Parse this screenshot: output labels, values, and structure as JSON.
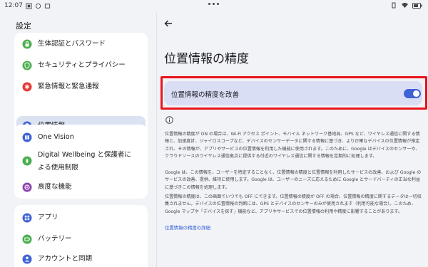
{
  "status_bar": {
    "time": "12:07"
  },
  "left_pane": {
    "title": "設定",
    "group1": [
      {
        "label": "生体認証とパスワード",
        "icon": "lock-icon",
        "color": "#4caf50"
      },
      {
        "label": "セキュリティとプライバシー",
        "icon": "shield-icon",
        "color": "#4caf50"
      },
      {
        "label": "緊急情報と緊急通報",
        "icon": "emergency-icon",
        "color": "#e53935"
      },
      {
        "label": "位置情報",
        "icon": "location-pin-icon",
        "color": "#3f63d6",
        "selected": true
      }
    ],
    "group2": [
      {
        "label": "One Vision",
        "icon": "one-vision-icon",
        "color": "#3f63d6"
      },
      {
        "label_line1": "Digital Wellbeing と保護者に",
        "label_line2": "よる使用制限",
        "icon": "wellbeing-icon",
        "color": "#4caf50"
      },
      {
        "label": "高度な機能",
        "icon": "advanced-features-icon",
        "color": "#8e44ad"
      }
    ],
    "group3": [
      {
        "label": "アプリ",
        "icon": "apps-icon",
        "color": "#3f63d6"
      },
      {
        "label": "バッテリー",
        "icon": "battery-icon",
        "color": "#4caf50"
      },
      {
        "label": "アカウントと同期",
        "icon": "account-icon",
        "color": "#3f63d6"
      }
    ]
  },
  "right_pane": {
    "page_title": "位置情報の精度",
    "toggle": {
      "label": "位置情報の精度を改善",
      "state": "on",
      "color": "#3f63d6"
    },
    "description": {
      "p1": "位置情報の精度が ON の場合は、Wi-Fi アクセス ポイント、モバイル ネットワーク基地局、GPS など、ワイヤレス通信に関する情報と、加速度計、ジャイロスコープなど、デバイスのセンサーデータに関する情報に基づき、より正確なデバイスの位置情報が推定され、その情報が、アプリやサービスの位置情報を利用した機能に使用されます。このために、Google はデバイスのセンサーや、クラウドソースのワイヤレス通信拠点に提供する付近のワイヤレス通信に関する情報を定期的に処理します。",
      "p2": "Google は、この情報を、ユーザーを特定することなく、位置情報の精度と位置情報を利用したサービスの改善、および Google のサービスの改善、提供、維持に使用します。Google は、ユーザーのニーズに応えるために Google とサードパーティの正当な利益に基づきこの情報を処理します。",
      "p3": "位置情報の精度は、この画面でいつでも OFF にできます。位置情報の精度が OFF の場合、位置情報の精度に関するデータは一切収集されません。デバイスの位置情報の判断には、GPS とデバイスのセンサーのみが使用されます（利用可能な場合）。このため、Google マップや「デバイスを探す」機能など、アプリやサービスでの位置情報の利用や精度に影響することがあります。",
      "link": "位置情報の精度の詳細"
    }
  }
}
